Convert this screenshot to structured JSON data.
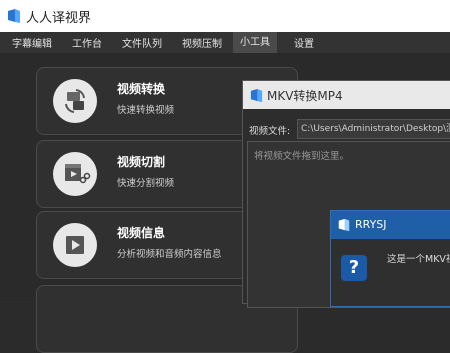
{
  "app": {
    "title": "人人译视界"
  },
  "menu": [
    {
      "label": "字幕编辑"
    },
    {
      "label": "工作台"
    },
    {
      "label": "文件队列"
    },
    {
      "label": "视频压制"
    },
    {
      "label": "小工具"
    },
    {
      "label": "设置"
    }
  ],
  "cards": [
    {
      "title": "视频转换",
      "desc": "快速转换视频",
      "icon": "video-convert-icon"
    },
    {
      "title": "视频切割",
      "desc": "快速分割视频",
      "icon": "video-cut-icon"
    },
    {
      "title": "视频信息",
      "desc": "分析视频和音频内容信息",
      "icon": "video-info-icon"
    }
  ],
  "dialog_convert": {
    "title": "MKV转换MP4",
    "file_label": "视频文件:",
    "file_path": "C:\\Users\\Administrator\\Desktop\\测",
    "drop_hint": "将视频文件拖到这里。"
  },
  "dialog_message": {
    "title": "RRYSJ",
    "message": "这是一个MKV视",
    "icon": "question-icon"
  },
  "colors": {
    "dialog_accent": "#1e5fa8",
    "background": "#2b2b2b"
  }
}
